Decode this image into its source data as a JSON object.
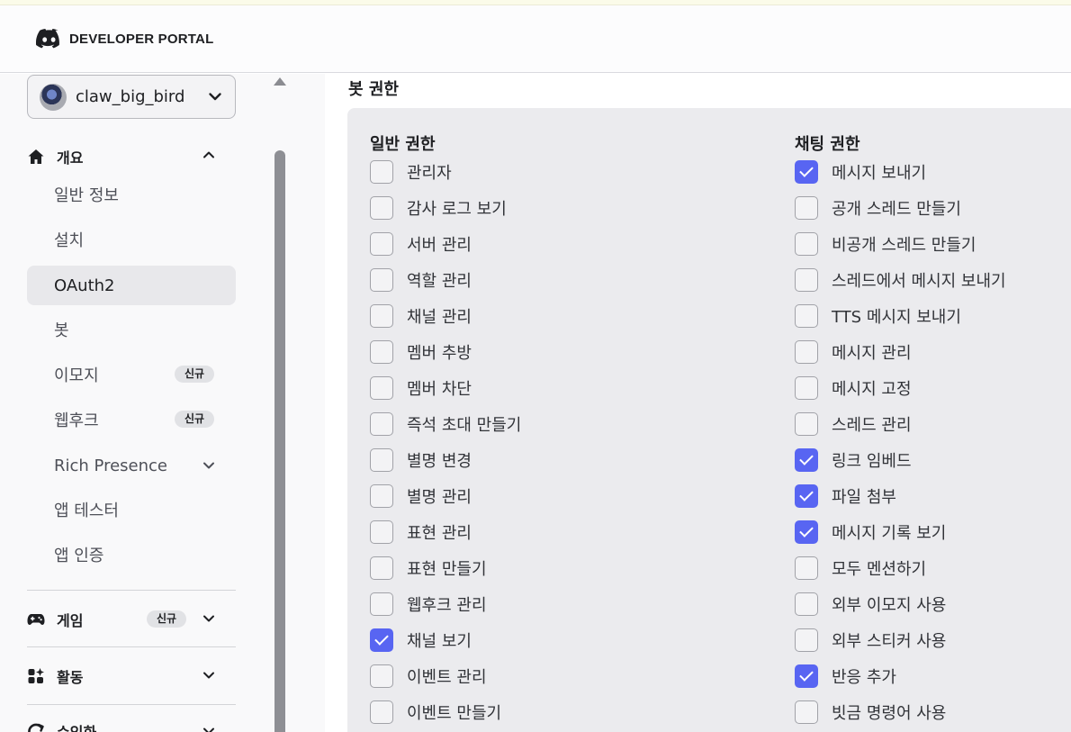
{
  "header": {
    "logo_text": "DEVELOPER PORTAL"
  },
  "sidebar": {
    "app_selector": {
      "name": "claw_big_bird"
    },
    "overview": {
      "title": "개요",
      "items": [
        {
          "label": "일반 정보"
        },
        {
          "label": "설치"
        },
        {
          "label": "OAuth2",
          "active": true
        },
        {
          "label": "봇"
        },
        {
          "label": "이모지",
          "badge": "신규"
        },
        {
          "label": "웹후크",
          "badge": "신규"
        },
        {
          "label": "Rich Presence"
        },
        {
          "label": "앱 테스터"
        },
        {
          "label": "앱 인증"
        }
      ]
    },
    "games": {
      "title": "게임",
      "badge": "신규"
    },
    "activities": {
      "title": "활동"
    },
    "monetization": {
      "title": "수익화"
    }
  },
  "main": {
    "title": "봇 권한",
    "general": {
      "title": "일반 권한",
      "perms": [
        {
          "label": "관리자",
          "checked": false
        },
        {
          "label": "감사 로그 보기",
          "checked": false
        },
        {
          "label": "서버 관리",
          "checked": false
        },
        {
          "label": "역할 관리",
          "checked": false
        },
        {
          "label": "채널 관리",
          "checked": false
        },
        {
          "label": "멤버 추방",
          "checked": false
        },
        {
          "label": "멤버 차단",
          "checked": false
        },
        {
          "label": "즉석 초대 만들기",
          "checked": false
        },
        {
          "label": "별명 변경",
          "checked": false
        },
        {
          "label": "별명 관리",
          "checked": false
        },
        {
          "label": "표현 관리",
          "checked": false
        },
        {
          "label": "표현 만들기",
          "checked": false
        },
        {
          "label": "웹후크 관리",
          "checked": false
        },
        {
          "label": "채널 보기",
          "checked": true
        },
        {
          "label": "이벤트 관리",
          "checked": false
        },
        {
          "label": "이벤트 만들기",
          "checked": false
        }
      ]
    },
    "text": {
      "title": "채팅 권한",
      "perms": [
        {
          "label": "메시지 보내기",
          "checked": true
        },
        {
          "label": "공개 스레드 만들기",
          "checked": false
        },
        {
          "label": "비공개 스레드 만들기",
          "checked": false
        },
        {
          "label": "스레드에서 메시지 보내기",
          "checked": false
        },
        {
          "label": "TTS 메시지 보내기",
          "checked": false
        },
        {
          "label": "메시지 관리",
          "checked": false
        },
        {
          "label": "메시지 고정",
          "checked": false
        },
        {
          "label": "스레드 관리",
          "checked": false
        },
        {
          "label": "링크 임베드",
          "checked": true
        },
        {
          "label": "파일 첨부",
          "checked": true
        },
        {
          "label": "메시지 기록 보기",
          "checked": true
        },
        {
          "label": "모두 멘션하기",
          "checked": false
        },
        {
          "label": "외부 이모지 사용",
          "checked": false
        },
        {
          "label": "외부 스티커 사용",
          "checked": false
        },
        {
          "label": "반응 추가",
          "checked": true
        },
        {
          "label": "빗금 명령어 사용",
          "checked": false
        }
      ]
    }
  }
}
